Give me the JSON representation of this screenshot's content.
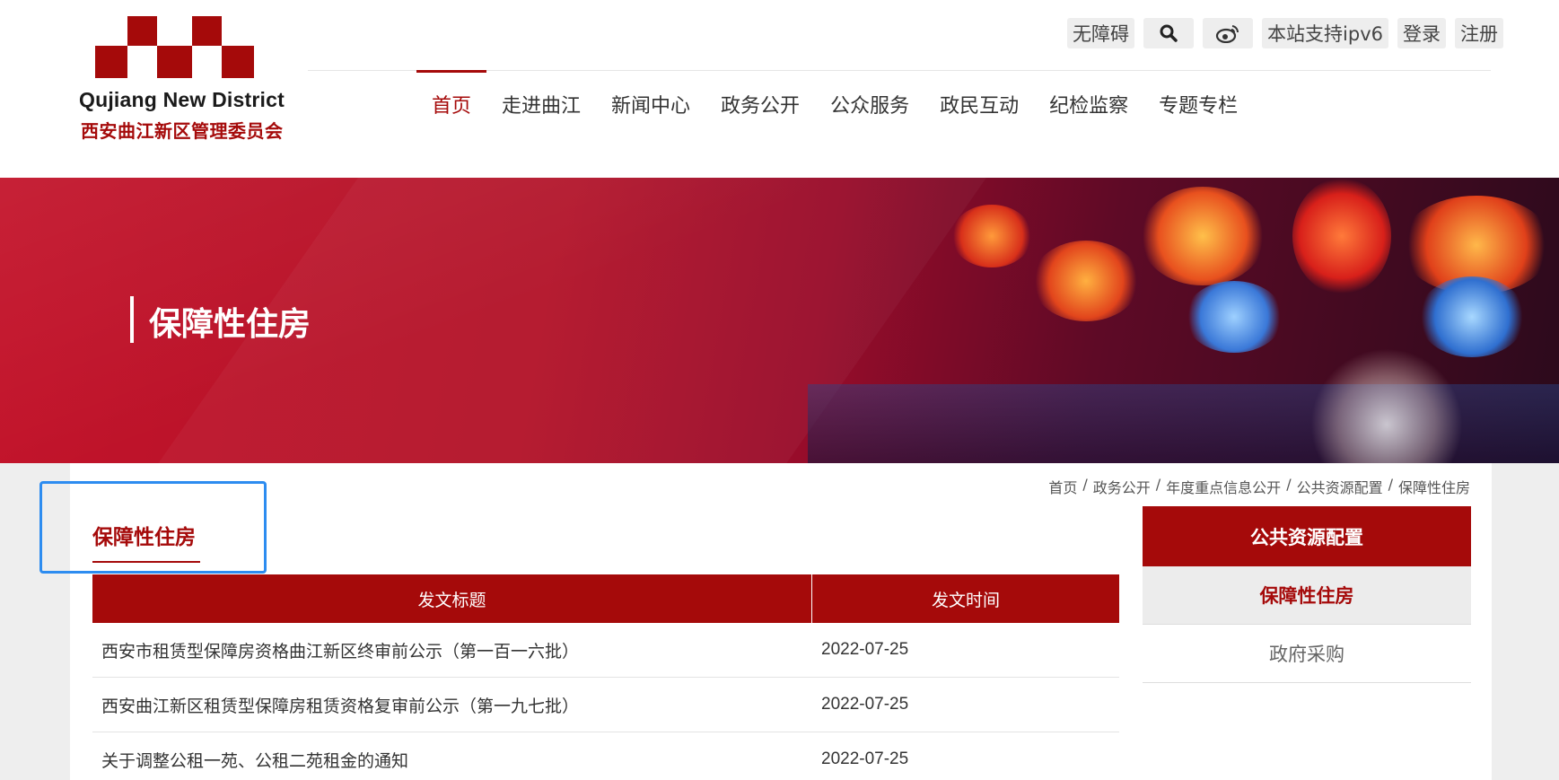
{
  "logo": {
    "en": "Qujiang New District",
    "cn": "西安曲江新区管理委员会",
    "brand_color": "#a50a0a"
  },
  "topbar": {
    "accessibility": "无障碍",
    "search_icon": "search-icon",
    "weibo_icon": "weibo-icon",
    "ipv6": "本站支持ipv6",
    "login": "登录",
    "register": "注册"
  },
  "nav": {
    "items": [
      {
        "label": "首页",
        "active": true
      },
      {
        "label": "走进曲江"
      },
      {
        "label": "新闻中心"
      },
      {
        "label": "政务公开"
      },
      {
        "label": "公众服务"
      },
      {
        "label": "政民互动"
      },
      {
        "label": "纪检监察"
      },
      {
        "label": "专题专栏"
      }
    ]
  },
  "banner": {
    "title": "保障性住房"
  },
  "breadcrumb": [
    "首页",
    "政务公开",
    "年度重点信息公开",
    "公共资源配置",
    "保障性住房"
  ],
  "breadcrumb_sep": "/",
  "section": {
    "title": "保障性住房"
  },
  "table": {
    "headers": [
      "发文标题",
      "发文时间"
    ],
    "rows": [
      {
        "title": "西安市租赁型保障房资格曲江新区终审前公示（第一百一六批）",
        "date": "2022-07-25"
      },
      {
        "title": "西安曲江新区租赁型保障房租赁资格复审前公示（第一九七批）",
        "date": "2022-07-25"
      },
      {
        "title": "关于调整公租一苑、公租二苑租金的通知",
        "date": "2022-07-25"
      }
    ]
  },
  "sidebar": {
    "heading": "公共资源配置",
    "items": [
      {
        "label": "保障性住房",
        "active": true
      },
      {
        "label": "政府采购"
      }
    ]
  }
}
